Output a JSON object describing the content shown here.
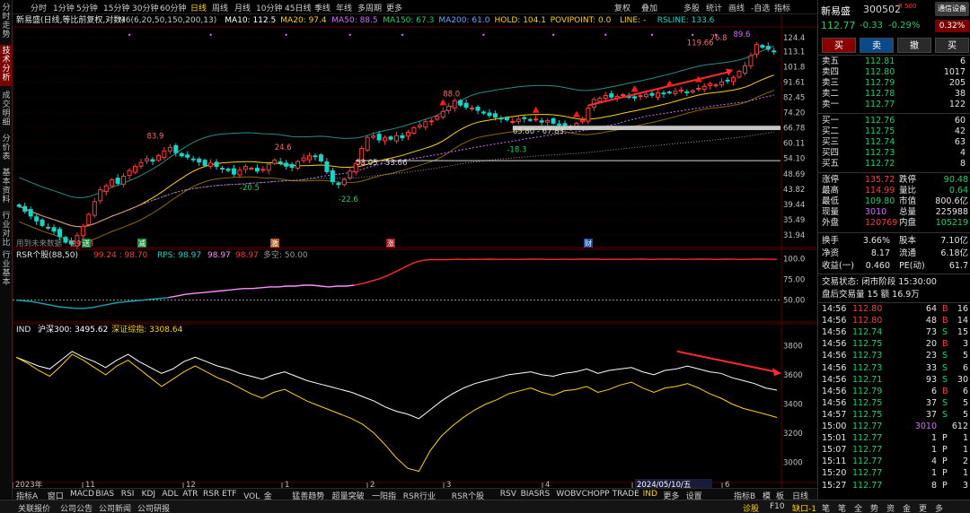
{
  "nav": {
    "items": [
      "分时走势",
      "技术分析",
      "成交明细",
      "分价表",
      "基本资料",
      "行业对比",
      "行业基本"
    ],
    "active": 1
  },
  "toolbar": {
    "periods": [
      "分时",
      "1分钟",
      "5分钟",
      "15分钟",
      "30分钟",
      "60分钟",
      "日线",
      "周线",
      "月线",
      "10分钟",
      "45日线",
      "季线",
      "年线",
      "多周期",
      "更多"
    ],
    "active": "日线",
    "right": [
      "复权",
      "叠加",
      "多股",
      "统计",
      "画线",
      "-自选",
      "指标"
    ]
  },
  "legend": {
    "title": "新易盛(日线,等比前复权,对数)",
    "items": [
      {
        "text": "M6(6,20,50,150,200,13)",
        "color": "#c8c8c8"
      },
      {
        "text": "MA10: 112.5",
        "color": "#ffffff"
      },
      {
        "text": "MA20: 97.4",
        "color": "#ffd200"
      },
      {
        "text": "MA50: 88.5",
        "color": "#d46cff"
      },
      {
        "text": "MA150: 67.3",
        "color": "#19d36a"
      },
      {
        "text": "MA200: 61.0",
        "color": "#6aa3ff"
      },
      {
        "text": "HOLD: 104.1",
        "color": "#ffd200"
      },
      {
        "text": "POVIPOINT: 0.0",
        "color": "#ffd200"
      },
      {
        "text": "LINE: -",
        "color": "#ffd200"
      },
      {
        "text": "RSLINE: 133.6",
        "color": "#19d3c8"
      }
    ]
  },
  "chart_data": [
    {
      "type": "candlestick",
      "title": "新易盛(日线,等比前复权,对数)",
      "scale": "log",
      "ylim": [
        31.94,
        124.4
      ],
      "y_ticks": [
        "124.4",
        "113.1",
        "101.8",
        "91.61",
        "82.45",
        "74.20",
        "66.78",
        "60.11",
        "54.10",
        "48.69",
        "43.82",
        "39.44",
        "35.49",
        "31.94"
      ],
      "x_ticks": [
        "2023年",
        "11",
        "12",
        "1",
        "2",
        "3",
        "4",
        "5",
        "6"
      ],
      "crosshair_date": "2024/05/10/五",
      "annotations": [
        "83.9",
        "24.6",
        "-20.5",
        "-22.6",
        "29.98",
        "88.0",
        "53.05 - 53.66",
        "65.80 - 67.83",
        "-18.3",
        "119.66",
        "76.8",
        "89.6"
      ],
      "footnote": "用到未来数据",
      "events": [
        {
          "label": "送",
          "color": "#1a8a3a"
        },
        {
          "label": "减",
          "color": "#1a8a3a"
        },
        {
          "label": "激",
          "color": "#b05a1a"
        },
        {
          "label": "涨",
          "color": "#a01a1a"
        },
        {
          "label": "财",
          "color": "#1a4a9a"
        }
      ],
      "close": [
        38.9,
        37.6,
        36.4,
        35.2,
        34.1,
        33.6,
        32.8,
        31.6,
        30.4,
        30.0,
        31.8,
        33.9,
        36.8,
        40.2,
        43.6,
        44.8,
        46.7,
        45.6,
        47.9,
        49.8,
        51.3,
        52.6,
        54.0,
        53.1,
        55.2,
        57.0,
        58.4,
        56.3,
        55.1,
        54.6,
        53.9,
        52.8,
        51.6,
        52.4,
        51.2,
        50.3,
        49.8,
        48.6,
        49.9,
        51.2,
        50.6,
        49.6,
        50.2,
        52.0,
        53.5,
        52.4,
        51.3,
        50.9,
        53.0,
        54.3,
        55.1,
        54.8,
        53.2,
        49.4,
        46.1,
        45.2,
        46.8,
        49.6,
        52.3,
        58.0,
        62.6,
        63.2,
        61.5,
        62.4,
        61.8,
        63.3,
        62.4,
        64.8,
        66.9,
        68.0,
        69.7,
        70.1,
        72.4,
        74.8,
        77.6,
        80.6,
        78.2,
        77.0,
        76.6,
        75.4,
        74.0,
        72.8,
        71.9,
        71.1,
        70.6,
        69.8,
        70.9,
        71.2,
        70.4,
        71.0,
        69.5,
        70.3,
        69.0,
        68.4,
        68.0,
        67.3,
        68.9,
        70.4,
        76.6,
        81.2,
        82.0,
        83.5,
        82.6,
        83.0,
        84.0,
        82.8,
        82.1,
        83.4,
        84.2,
        83.6,
        85.0,
        84.5,
        85.1,
        85.9,
        86.7,
        85.5,
        86.3,
        87.7,
        88.9,
        90.4,
        89.8,
        91.7,
        92.5,
        94.3,
        98.6,
        102.5,
        109.8,
        118.6,
        116.5,
        114.9,
        112.8
      ]
    },
    {
      "type": "line",
      "title": "RSR个股(88,50)",
      "series": [
        {
          "name": "99.24 : 98.70",
          "color": "#ff3b3b"
        },
        {
          "name": "RPS: 98.97",
          "color": "#19d3c8"
        },
        {
          "name": "98.97",
          "color": "#ff8cff"
        },
        {
          "name": "98.97",
          "color": "#ff3b3b"
        },
        {
          "name": "多空: 50.00",
          "color": "#9a9a9a"
        }
      ],
      "y_ticks": [
        "100.0",
        "75.00",
        "50.00"
      ],
      "ylim": [
        30,
        105
      ],
      "values": [
        50,
        49,
        48,
        46,
        44,
        42,
        41,
        40,
        40,
        41,
        43,
        45,
        47,
        48,
        49,
        50,
        51,
        52,
        53,
        55,
        57,
        58,
        59,
        60,
        61,
        62,
        63,
        64,
        64,
        65,
        66,
        66,
        67,
        67,
        68,
        68,
        67,
        66,
        67,
        67,
        68,
        70,
        73,
        76,
        80,
        85,
        90,
        95,
        98,
        99,
        99,
        99,
        99.5,
        99.2,
        99.5,
        99.3,
        99.6,
        99.4,
        99.5,
        99.3,
        99.4,
        99.6,
        99.5,
        99.4,
        99.3,
        99.5,
        99.4,
        99.6,
        99.7,
        99.5,
        99.4,
        99.5,
        99.3,
        99.5,
        99.6,
        99.4,
        99.5,
        99.6,
        99.5,
        99.4,
        99.5,
        99.6,
        99.5,
        99.4,
        99.6,
        99.5,
        99.4,
        99.5,
        99.6,
        99.5,
        99.4
      ]
    },
    {
      "type": "line",
      "title": "IND",
      "series": [
        {
          "name": "沪深300: 3495.62",
          "color": "#ffffff",
          "values": [
            3720,
            3690,
            3660,
            3640,
            3700,
            3760,
            3720,
            3690,
            3650,
            3700,
            3740,
            3690,
            3650,
            3610,
            3640,
            3690,
            3720,
            3690,
            3660,
            3640,
            3610,
            3590,
            3570,
            3600,
            3620,
            3590,
            3560,
            3540,
            3520,
            3500,
            3480,
            3450,
            3420,
            3380,
            3350,
            3330,
            3300,
            3360,
            3420,
            3470,
            3510,
            3540,
            3560,
            3580,
            3600,
            3610,
            3620,
            3600,
            3590,
            3610,
            3620,
            3640,
            3610,
            3630,
            3640,
            3650,
            3620,
            3600,
            3630,
            3640,
            3660,
            3640,
            3620,
            3610,
            3580,
            3560,
            3540,
            3510,
            3495
          ]
        },
        {
          "name": "深证综指: 3308.64",
          "color": "#ffd200",
          "values": [
            3720,
            3680,
            3630,
            3590,
            3660,
            3740,
            3700,
            3650,
            3600,
            3660,
            3700,
            3640,
            3580,
            3520,
            3570,
            3620,
            3660,
            3620,
            3580,
            3550,
            3510,
            3470,
            3440,
            3480,
            3500,
            3460,
            3420,
            3390,
            3360,
            3330,
            3300,
            3260,
            3200,
            3120,
            3030,
            2960,
            2940,
            3080,
            3180,
            3250,
            3310,
            3360,
            3400,
            3430,
            3470,
            3490,
            3510,
            3480,
            3460,
            3490,
            3500,
            3520,
            3480,
            3500,
            3530,
            3550,
            3510,
            3480,
            3510,
            3520,
            3540,
            3510,
            3470,
            3440,
            3400,
            3370,
            3350,
            3330,
            3308
          ]
        }
      ],
      "y_ticks": [
        "3800",
        "3600",
        "3400",
        "3200",
        "3000"
      ],
      "ylim": [
        2900,
        3900
      ]
    }
  ],
  "bottom_tabs": {
    "items": [
      "指标A",
      "窗口",
      "MACD",
      "BIAS",
      "RSI",
      "KDJ",
      "ADL",
      "ATR",
      "RSR ETF",
      "VOL_金",
      "猛善趋势",
      "超量突破",
      "一阳指",
      "RSR行业",
      "RSR个股",
      "RSV",
      "BIASRS",
      "WOBV",
      "CHOPP",
      "TRADE",
      "IND",
      "更多",
      "设置"
    ],
    "active": "IND",
    "right": [
      "指标B",
      "模",
      "板",
      "日线"
    ]
  },
  "status": {
    "left": [
      "关联报价",
      "公司公告",
      "公司新闻",
      "公司研报"
    ],
    "right": [
      "诊股",
      "F10",
      "缺口-1",
      "笔",
      "笔",
      "全",
      "势",
      "资",
      "金",
      "更",
      "多"
    ]
  },
  "quote": {
    "name": "新易盛",
    "code": "300502",
    "badge": "R 500",
    "trade_btn": "通信设备",
    "price": "112.77",
    "change": "-0.33",
    "change_pct": "-0.29%",
    "ratio": "0.32%",
    "buttons": [
      "买",
      "卖",
      "撤",
      "买"
    ],
    "asks": [
      {
        "label": "卖五",
        "price": "112.81",
        "vol": "6"
      },
      {
        "label": "卖四",
        "price": "112.80",
        "vol": "1017"
      },
      {
        "label": "卖三",
        "price": "112.79",
        "vol": "205"
      },
      {
        "label": "卖二",
        "price": "112.78",
        "vol": "38"
      },
      {
        "label": "卖一",
        "price": "112.77",
        "vol": "122"
      }
    ],
    "bids": [
      {
        "label": "买一",
        "price": "112.76",
        "vol": "60"
      },
      {
        "label": "买二",
        "price": "112.75",
        "vol": "42"
      },
      {
        "label": "买三",
        "price": "112.74",
        "vol": "63"
      },
      {
        "label": "买四",
        "price": "112.73",
        "vol": "4"
      },
      {
        "label": "买五",
        "price": "112.72",
        "vol": "8"
      }
    ],
    "stats": [
      {
        "l1": "涨停",
        "v1": "135.72",
        "c1": "red",
        "l2": "跌停",
        "v2": "90.48",
        "c2": "grn"
      },
      {
        "l1": "最高",
        "v1": "114.99",
        "c1": "red",
        "l2": "量比",
        "v2": "0.64",
        "c2": "grn"
      },
      {
        "l1": "最低",
        "v1": "109.80",
        "c1": "grn",
        "l2": "市值",
        "v2": "800.6亿",
        "c2": "wht"
      },
      {
        "l1": "现量",
        "v1": "3010",
        "c1": "pur",
        "l2": "总量",
        "v2": "225988",
        "c2": "wht"
      },
      {
        "l1": "外盘",
        "v1": "120769",
        "c1": "red",
        "l2": "内盘",
        "v2": "105219",
        "c2": "grn"
      }
    ],
    "stats2": [
      {
        "l1": "换手",
        "v1": "3.66%",
        "l2": "股本",
        "v2": "7.10亿"
      },
      {
        "l1": "净资",
        "v1": "8.17",
        "l2": "流通",
        "v2": "6.18亿"
      },
      {
        "l1": "收益(一)",
        "v1": "0.460",
        "l2": "PE(动)",
        "v2": "61.7"
      }
    ],
    "trade_status": "交易状态: 闭市阶段 15:30:00",
    "after_hours": "盘后交易量 15 额 16.9万",
    "ticks": [
      {
        "t": "14:56",
        "p": "112.80",
        "v": "64",
        "s": "B",
        "n": "16",
        "pc": "red",
        "sc": "red"
      },
      {
        "t": "14:56",
        "p": "112.80",
        "v": "48",
        "s": "B",
        "n": "14",
        "pc": "red",
        "sc": "red"
      },
      {
        "t": "14:56",
        "p": "112.74",
        "v": "73",
        "s": "S",
        "n": "15",
        "pc": "grn",
        "sc": "grn"
      },
      {
        "t": "14:56",
        "p": "112.75",
        "v": "20",
        "s": "B",
        "n": "3",
        "pc": "grn",
        "sc": "red"
      },
      {
        "t": "14:56",
        "p": "112.73",
        "v": "23",
        "s": "S",
        "n": "5",
        "pc": "grn",
        "sc": "grn"
      },
      {
        "t": "14:56",
        "p": "112.73",
        "v": "33",
        "s": "S",
        "n": "6",
        "pc": "grn",
        "sc": "grn"
      },
      {
        "t": "14:56",
        "p": "112.71",
        "v": "93",
        "s": "S",
        "n": "30",
        "pc": "grn",
        "sc": "grn"
      },
      {
        "t": "14:56",
        "p": "112.79",
        "v": "6",
        "s": "B",
        "n": "6",
        "pc": "grn",
        "sc": "red"
      },
      {
        "t": "14:56",
        "p": "112.75",
        "v": "37",
        "s": "S",
        "n": "5",
        "pc": "grn",
        "sc": "grn"
      },
      {
        "t": "14:57",
        "p": "112.75",
        "v": "37",
        "s": "S",
        "n": "5",
        "pc": "grn",
        "sc": "grn"
      },
      {
        "t": "15:00",
        "p": "112.77",
        "v": "3010",
        "s": "",
        "n": "612",
        "pc": "grn",
        "sc": "pur"
      },
      {
        "t": "15:01",
        "p": "112.77",
        "v": "1",
        "s": "P",
        "n": "1",
        "pc": "grn",
        "sc": "wht"
      },
      {
        "t": "15:07",
        "p": "112.77",
        "v": "1",
        "s": "P",
        "n": "1",
        "pc": "grn",
        "sc": "wht"
      },
      {
        "t": "15:11",
        "p": "112.77",
        "v": "4",
        "s": "P",
        "n": "2",
        "pc": "grn",
        "sc": "wht"
      },
      {
        "t": "15:20",
        "p": "112.77",
        "v": "1",
        "s": "P",
        "n": "1",
        "pc": "grn",
        "sc": "wht"
      },
      {
        "t": "15:27",
        "p": "112.77",
        "v": "8",
        "s": "P",
        "n": "3",
        "pc": "grn",
        "sc": "wht"
      }
    ]
  },
  "colors": {
    "up": "#ff3b3b",
    "down": "#19d3c8",
    "grid": "#3a0000",
    "axis": "#9a9a9a"
  }
}
